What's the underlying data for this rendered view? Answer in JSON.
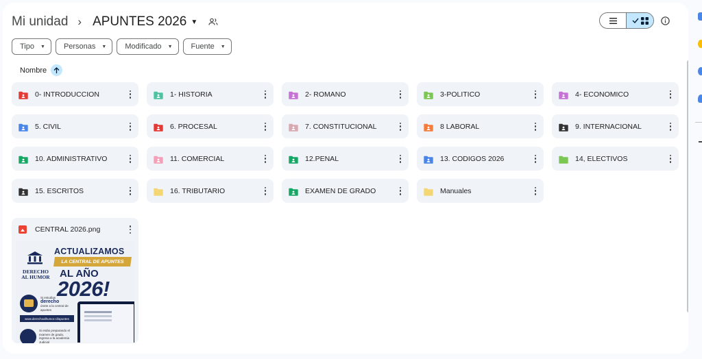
{
  "breadcrumb": {
    "root": "Mi unidad",
    "separator": "›",
    "current": "APUNTES 2026"
  },
  "icons": {
    "caret": "caret-down-icon",
    "shared": "shared-people-icon",
    "list_view": "list-view-icon",
    "grid_view": "grid-view-icon",
    "checkmark": "checkmark-icon",
    "info": "info-icon",
    "sort_up": "arrow-up-icon",
    "kebab": "more-vert-icon",
    "image": "image-file-icon"
  },
  "filters": [
    {
      "label": "Tipo"
    },
    {
      "label": "Personas"
    },
    {
      "label": "Modificado"
    },
    {
      "label": "Fuente"
    }
  ],
  "sort": {
    "label": "Nombre",
    "direction": "ascending"
  },
  "folders": [
    {
      "name": "0- INTRODUCCION",
      "color": "#e53935",
      "shared": true
    },
    {
      "name": "1- HISTORIA",
      "color": "#4fc3a1",
      "shared": true
    },
    {
      "name": "2- ROMANO",
      "color": "#c770d6",
      "shared": true
    },
    {
      "name": "3-POLITICO",
      "color": "#7cc653",
      "shared": true
    },
    {
      "name": "4- ECONOMICO",
      "color": "#c770d6",
      "shared": true
    },
    {
      "name": "5. CIVIL",
      "color": "#4a86e8",
      "shared": true
    },
    {
      "name": "6. PROCESAL",
      "color": "#e53935",
      "shared": true
    },
    {
      "name": "7. CONSTITUCIONAL",
      "color": "#d9a8b0",
      "shared": true
    },
    {
      "name": "8 LABORAL",
      "color": "#f57c3a",
      "shared": true
    },
    {
      "name": "9. INTERNACIONAL",
      "color": "#333333",
      "shared": true
    },
    {
      "name": "10. ADMINISTRATIVO",
      "color": "#16a765",
      "shared": true
    },
    {
      "name": "11. COMERCIAL",
      "color": "#f4a0b8",
      "shared": true
    },
    {
      "name": "12.PENAL",
      "color": "#16a765",
      "shared": true
    },
    {
      "name": "13. CODIGOS 2026",
      "color": "#4a86e8",
      "shared": true
    },
    {
      "name": "14, ELECTIVOS",
      "color": "#7cc653",
      "shared": false
    },
    {
      "name": "15. ESCRITOS",
      "color": "#333333",
      "shared": true
    },
    {
      "name": "16. TRIBUTARIO",
      "color": "#f4d774",
      "shared": false
    },
    {
      "name": "EXAMEN DE GRADO",
      "color": "#16a765",
      "shared": true
    },
    {
      "name": "Manuales",
      "color": "#f4d774",
      "shared": false
    }
  ],
  "file": {
    "name": "CENTRAL 2026.png",
    "thumbnail": {
      "headline": "ACTUALIZAMOS",
      "banner": "LA CENTRAL DE APUNTES",
      "line2": "AL AÑO",
      "year": "2026!",
      "logo_line1": "DERECHO",
      "logo_line2": "AL HUMOR",
      "small1_pre": "Si estudias",
      "small1_bold": "derecho",
      "small1_post": "únete a la central de apuntes",
      "url": "www.derechoalhumor.cl/apuntes",
      "small2": "Si estás preparando el examen de grado, ingresa a la academia Judicial"
    }
  },
  "colors": {
    "accent": "#c2e7ff",
    "card_bg": "#f0f4f9",
    "page_bg": "#f8fafd"
  }
}
